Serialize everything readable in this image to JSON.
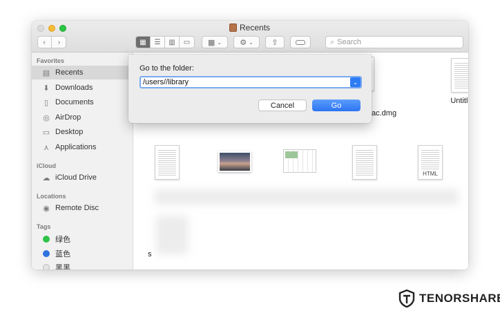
{
  "window": {
    "title": "Recents"
  },
  "toolbar": {
    "nav_back": "‹",
    "nav_forward": "›",
    "search_placeholder": "Search"
  },
  "sidebar": {
    "favorites_header": "Favorites",
    "favorites": [
      {
        "label": "Recents",
        "icon": "clock-icon"
      },
      {
        "label": "Downloads",
        "icon": "download-icon"
      },
      {
        "label": "Documents",
        "icon": "document-icon"
      },
      {
        "label": "AirDrop",
        "icon": "airdrop-icon"
      },
      {
        "label": "Desktop",
        "icon": "desktop-icon"
      },
      {
        "label": "Applications",
        "icon": "applications-icon"
      }
    ],
    "icloud_header": "iCloud",
    "icloud": [
      {
        "label": "iCloud Drive",
        "icon": "cloud-icon"
      }
    ],
    "locations_header": "Locations",
    "locations": [
      {
        "label": "Remote Disc",
        "icon": "disc-icon"
      }
    ],
    "tags_header": "Tags",
    "tags": [
      {
        "label": "绿色",
        "color": "#2fc24a"
      },
      {
        "label": "蓝色",
        "color": "#2f73e0"
      },
      {
        "label": "黑黑",
        "color": "#dddddd"
      }
    ]
  },
  "files": [
    {
      "label": "ac.dmg"
    },
    {
      "label": "Untitled"
    },
    {
      "label": "HTML"
    },
    {
      "label": "s"
    }
  ],
  "dialog": {
    "label": "Go to the folder:",
    "path_value": "/users//library",
    "cancel_label": "Cancel",
    "go_label": "Go"
  },
  "brand": {
    "name": "TENORSHARE"
  }
}
